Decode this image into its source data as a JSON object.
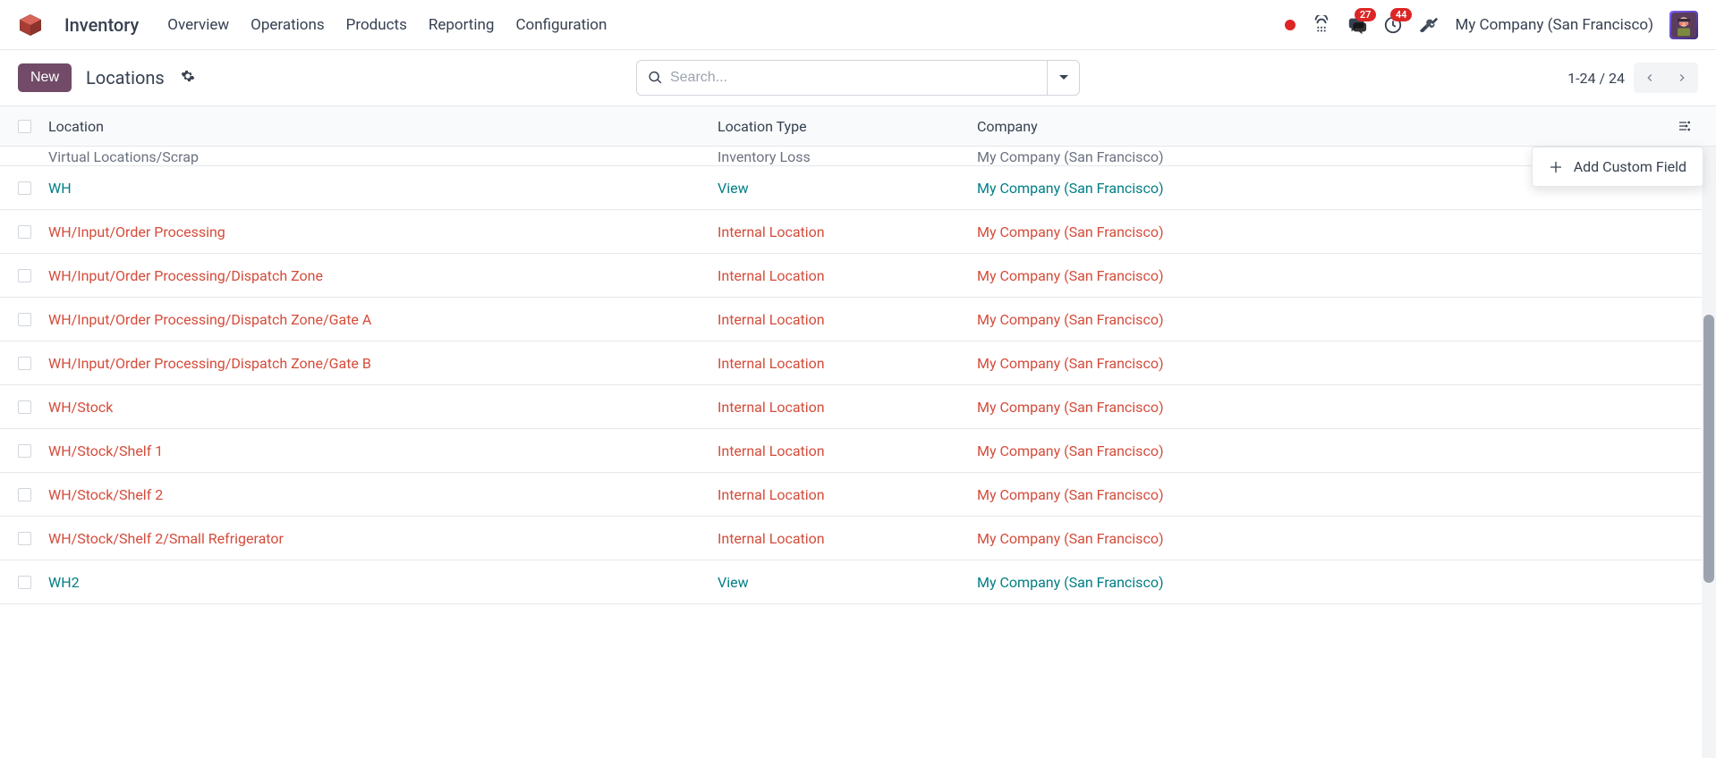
{
  "nav": {
    "app_title": "Inventory",
    "menu": [
      "Overview",
      "Operations",
      "Products",
      "Reporting",
      "Configuration"
    ],
    "badges": {
      "messages": "27",
      "activities": "44"
    },
    "company": "My Company (San Francisco)"
  },
  "controls": {
    "new_label": "New",
    "breadcrumb": "Locations",
    "search_placeholder": "Search...",
    "pager": "1-24 / 24"
  },
  "table": {
    "headers": {
      "location": "Location",
      "type": "Location Type",
      "company": "Company"
    },
    "cut_row": {
      "location": "Virtual Locations/Scrap",
      "type": "Inventory Loss",
      "company": "My Company (San Francisco)"
    },
    "rows": [
      {
        "location": "WH",
        "type": "View",
        "company": "My Company (San Francisco)",
        "color": "teal"
      },
      {
        "location": "WH/Input/Order Processing",
        "type": "Internal Location",
        "company": "My Company (San Francisco)",
        "color": "red"
      },
      {
        "location": "WH/Input/Order Processing/Dispatch Zone",
        "type": "Internal Location",
        "company": "My Company (San Francisco)",
        "color": "red"
      },
      {
        "location": "WH/Input/Order Processing/Dispatch Zone/Gate A",
        "type": "Internal Location",
        "company": "My Company (San Francisco)",
        "color": "red"
      },
      {
        "location": "WH/Input/Order Processing/Dispatch Zone/Gate B",
        "type": "Internal Location",
        "company": "My Company (San Francisco)",
        "color": "red"
      },
      {
        "location": "WH/Stock",
        "type": "Internal Location",
        "company": "My Company (San Francisco)",
        "color": "red"
      },
      {
        "location": "WH/Stock/Shelf 1",
        "type": "Internal Location",
        "company": "My Company (San Francisco)",
        "color": "red"
      },
      {
        "location": "WH/Stock/Shelf 2",
        "type": "Internal Location",
        "company": "My Company (San Francisco)",
        "color": "red"
      },
      {
        "location": "WH/Stock/Shelf 2/Small Refrigerator",
        "type": "Internal Location",
        "company": "My Company (San Francisco)",
        "color": "red"
      },
      {
        "location": "WH2",
        "type": "View",
        "company": "My Company (San Francisco)",
        "color": "teal"
      }
    ]
  },
  "float_menu": {
    "label": "Add Custom Field"
  }
}
